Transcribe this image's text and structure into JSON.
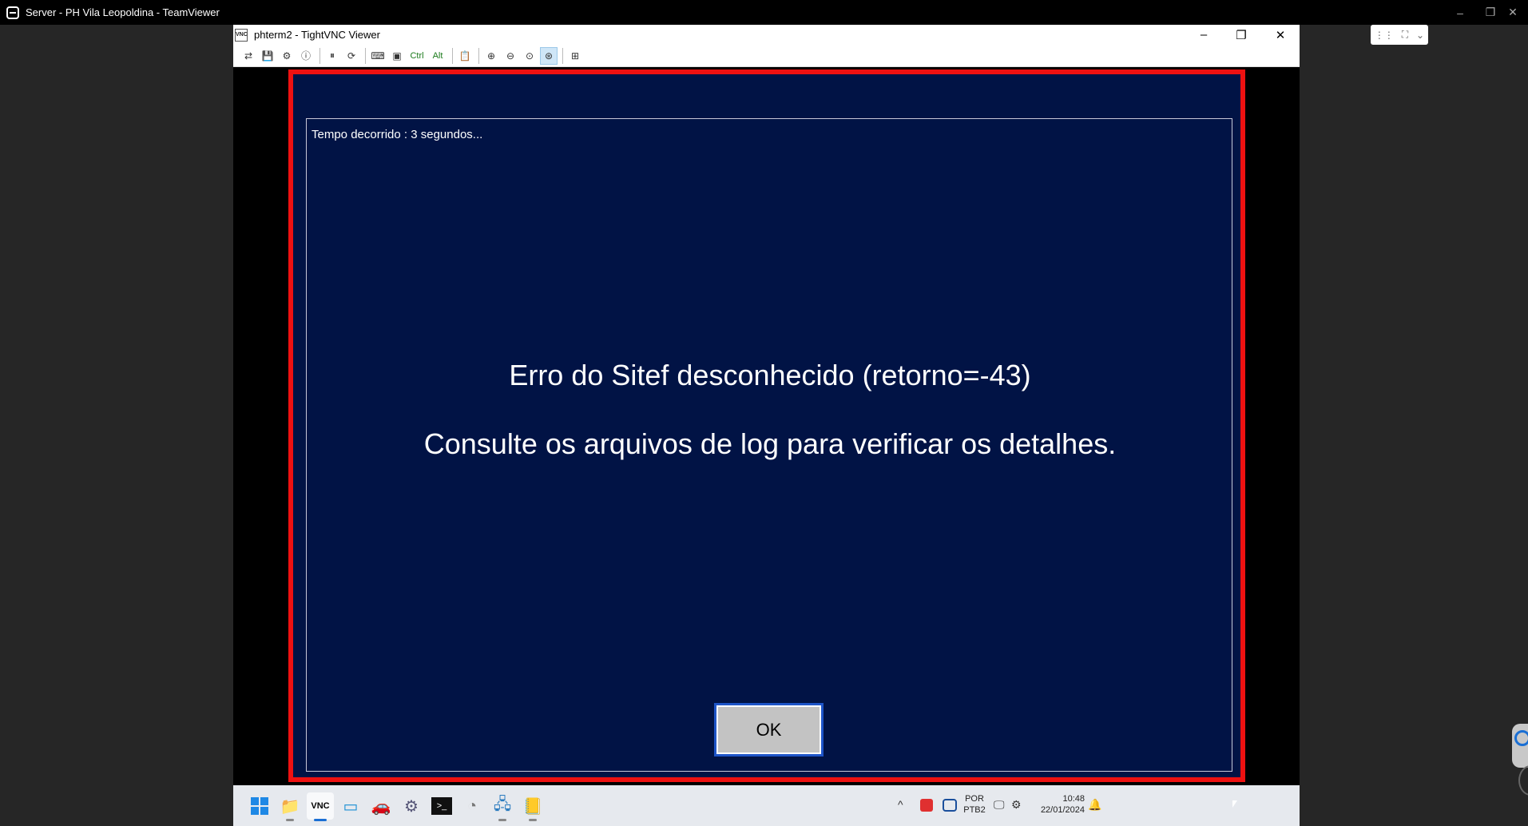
{
  "teamviewer": {
    "title": "Server - PH Vila Leopoldina - TeamViewer",
    "minimize_icon": "–",
    "restore_icon": "❐",
    "close_icon": "✕",
    "float_toolbar": {
      "grip_icon": "⋮⋮",
      "fullscreen_icon": "⛶",
      "expand_icon": "⌄"
    }
  },
  "vnc": {
    "title": "phterm2 - TightVNC Viewer",
    "icon_text": "VNC",
    "minimize_icon": "–",
    "restore_icon": "❐",
    "close_icon": "✕",
    "toolbar": {
      "new_connection": "⇄",
      "save": "💾",
      "options": "⚙",
      "info": "ⓘ",
      "pause": "⏸",
      "refresh": "⟳",
      "ctrl_alt_del": "⌨",
      "ctrl_esc": "▣",
      "ctrl": "Ctrl",
      "alt": "Alt",
      "clipboard": "📋",
      "zoom_in": "⊕",
      "zoom_out": "⊖",
      "zoom_100": "⊙",
      "zoom_fit": "⊛",
      "fullscreen": "⊞"
    }
  },
  "dialog": {
    "elapsed": "Tempo decorrido : 3 segundos...",
    "message_line1": "Erro do Sitef desconhecido (retorno=-43)",
    "message_line2": "Consulte os arquivos de log para verificar os detalhes.",
    "ok_label": "OK"
  },
  "taskbar": {
    "apps": {
      "explorer": "📁",
      "tightvnc": "VNC",
      "remote": "▭",
      "tool": "🚗",
      "settings": "⚙",
      "terminal": ">_",
      "clock": "◔",
      "network": "🖧",
      "notepad": "📒"
    },
    "tray": {
      "chevron": "^",
      "language_line1": "POR",
      "language_line2": "PTB2",
      "time": "10:48",
      "date": "22/01/2024",
      "bell": "🔔",
      "network_icon": "🖵",
      "volume_icon": "⚙"
    }
  },
  "colors": {
    "screen_bg": "#011345",
    "frame_red": "#ee1111",
    "ok_border": "#1e55c8"
  }
}
